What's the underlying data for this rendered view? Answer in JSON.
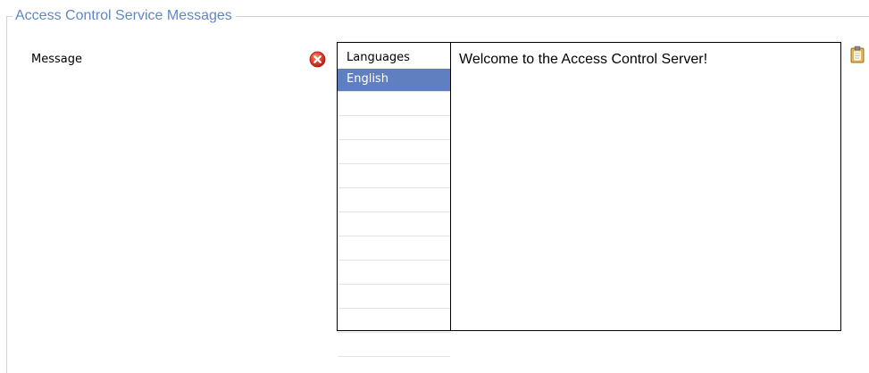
{
  "group": {
    "title": "Access Control Service Messages"
  },
  "message": {
    "label": "Message",
    "error_icon": "error-x-icon",
    "clipboard_icon": "clipboard-icon",
    "text": "Welcome to the Access Control Server!"
  },
  "languages": {
    "header": "Languages",
    "items": [
      {
        "label": "English",
        "selected": true
      },
      {
        "label": "",
        "selected": false
      },
      {
        "label": "",
        "selected": false
      },
      {
        "label": "",
        "selected": false
      },
      {
        "label": "",
        "selected": false
      },
      {
        "label": "",
        "selected": false
      },
      {
        "label": "",
        "selected": false
      },
      {
        "label": "",
        "selected": false
      },
      {
        "label": "",
        "selected": false
      },
      {
        "label": "",
        "selected": false
      },
      {
        "label": "",
        "selected": false
      },
      {
        "label": "",
        "selected": false
      }
    ]
  },
  "colors": {
    "legend_text": "#5f88c4",
    "selection": "#5f7fc0",
    "error_red": "#e8402e",
    "clipboard_gold": "#e8b84a"
  }
}
